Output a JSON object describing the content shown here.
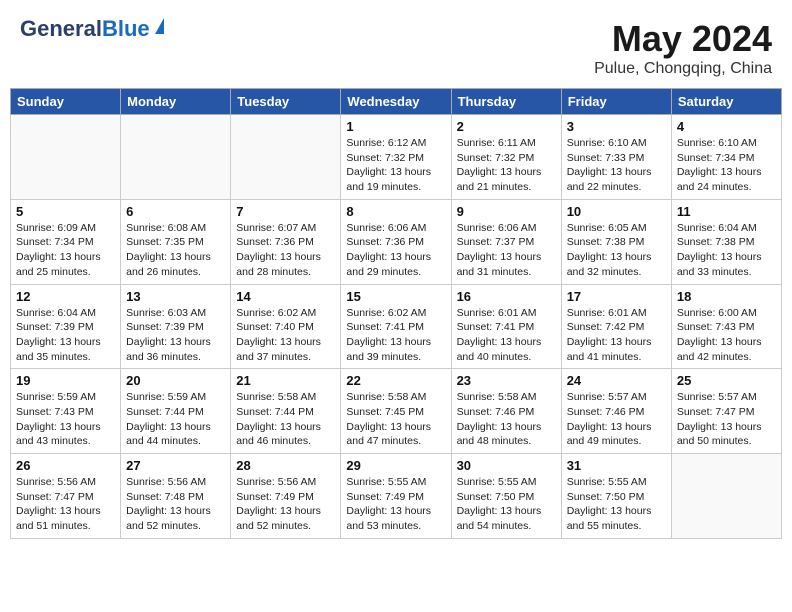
{
  "header": {
    "logo_general": "General",
    "logo_blue": "Blue",
    "month_year": "May 2024",
    "location": "Pulue, Chongqing, China"
  },
  "weekdays": [
    "Sunday",
    "Monday",
    "Tuesday",
    "Wednesday",
    "Thursday",
    "Friday",
    "Saturday"
  ],
  "weeks": [
    [
      {
        "day": "",
        "info": ""
      },
      {
        "day": "",
        "info": ""
      },
      {
        "day": "",
        "info": ""
      },
      {
        "day": "1",
        "info": "Sunrise: 6:12 AM\nSunset: 7:32 PM\nDaylight: 13 hours\nand 19 minutes."
      },
      {
        "day": "2",
        "info": "Sunrise: 6:11 AM\nSunset: 7:32 PM\nDaylight: 13 hours\nand 21 minutes."
      },
      {
        "day": "3",
        "info": "Sunrise: 6:10 AM\nSunset: 7:33 PM\nDaylight: 13 hours\nand 22 minutes."
      },
      {
        "day": "4",
        "info": "Sunrise: 6:10 AM\nSunset: 7:34 PM\nDaylight: 13 hours\nand 24 minutes."
      }
    ],
    [
      {
        "day": "5",
        "info": "Sunrise: 6:09 AM\nSunset: 7:34 PM\nDaylight: 13 hours\nand 25 minutes."
      },
      {
        "day": "6",
        "info": "Sunrise: 6:08 AM\nSunset: 7:35 PM\nDaylight: 13 hours\nand 26 minutes."
      },
      {
        "day": "7",
        "info": "Sunrise: 6:07 AM\nSunset: 7:36 PM\nDaylight: 13 hours\nand 28 minutes."
      },
      {
        "day": "8",
        "info": "Sunrise: 6:06 AM\nSunset: 7:36 PM\nDaylight: 13 hours\nand 29 minutes."
      },
      {
        "day": "9",
        "info": "Sunrise: 6:06 AM\nSunset: 7:37 PM\nDaylight: 13 hours\nand 31 minutes."
      },
      {
        "day": "10",
        "info": "Sunrise: 6:05 AM\nSunset: 7:38 PM\nDaylight: 13 hours\nand 32 minutes."
      },
      {
        "day": "11",
        "info": "Sunrise: 6:04 AM\nSunset: 7:38 PM\nDaylight: 13 hours\nand 33 minutes."
      }
    ],
    [
      {
        "day": "12",
        "info": "Sunrise: 6:04 AM\nSunset: 7:39 PM\nDaylight: 13 hours\nand 35 minutes."
      },
      {
        "day": "13",
        "info": "Sunrise: 6:03 AM\nSunset: 7:39 PM\nDaylight: 13 hours\nand 36 minutes."
      },
      {
        "day": "14",
        "info": "Sunrise: 6:02 AM\nSunset: 7:40 PM\nDaylight: 13 hours\nand 37 minutes."
      },
      {
        "day": "15",
        "info": "Sunrise: 6:02 AM\nSunset: 7:41 PM\nDaylight: 13 hours\nand 39 minutes."
      },
      {
        "day": "16",
        "info": "Sunrise: 6:01 AM\nSunset: 7:41 PM\nDaylight: 13 hours\nand 40 minutes."
      },
      {
        "day": "17",
        "info": "Sunrise: 6:01 AM\nSunset: 7:42 PM\nDaylight: 13 hours\nand 41 minutes."
      },
      {
        "day": "18",
        "info": "Sunrise: 6:00 AM\nSunset: 7:43 PM\nDaylight: 13 hours\nand 42 minutes."
      }
    ],
    [
      {
        "day": "19",
        "info": "Sunrise: 5:59 AM\nSunset: 7:43 PM\nDaylight: 13 hours\nand 43 minutes."
      },
      {
        "day": "20",
        "info": "Sunrise: 5:59 AM\nSunset: 7:44 PM\nDaylight: 13 hours\nand 44 minutes."
      },
      {
        "day": "21",
        "info": "Sunrise: 5:58 AM\nSunset: 7:44 PM\nDaylight: 13 hours\nand 46 minutes."
      },
      {
        "day": "22",
        "info": "Sunrise: 5:58 AM\nSunset: 7:45 PM\nDaylight: 13 hours\nand 47 minutes."
      },
      {
        "day": "23",
        "info": "Sunrise: 5:58 AM\nSunset: 7:46 PM\nDaylight: 13 hours\nand 48 minutes."
      },
      {
        "day": "24",
        "info": "Sunrise: 5:57 AM\nSunset: 7:46 PM\nDaylight: 13 hours\nand 49 minutes."
      },
      {
        "day": "25",
        "info": "Sunrise: 5:57 AM\nSunset: 7:47 PM\nDaylight: 13 hours\nand 50 minutes."
      }
    ],
    [
      {
        "day": "26",
        "info": "Sunrise: 5:56 AM\nSunset: 7:47 PM\nDaylight: 13 hours\nand 51 minutes."
      },
      {
        "day": "27",
        "info": "Sunrise: 5:56 AM\nSunset: 7:48 PM\nDaylight: 13 hours\nand 52 minutes."
      },
      {
        "day": "28",
        "info": "Sunrise: 5:56 AM\nSunset: 7:49 PM\nDaylight: 13 hours\nand 52 minutes."
      },
      {
        "day": "29",
        "info": "Sunrise: 5:55 AM\nSunset: 7:49 PM\nDaylight: 13 hours\nand 53 minutes."
      },
      {
        "day": "30",
        "info": "Sunrise: 5:55 AM\nSunset: 7:50 PM\nDaylight: 13 hours\nand 54 minutes."
      },
      {
        "day": "31",
        "info": "Sunrise: 5:55 AM\nSunset: 7:50 PM\nDaylight: 13 hours\nand 55 minutes."
      },
      {
        "day": "",
        "info": ""
      }
    ]
  ]
}
